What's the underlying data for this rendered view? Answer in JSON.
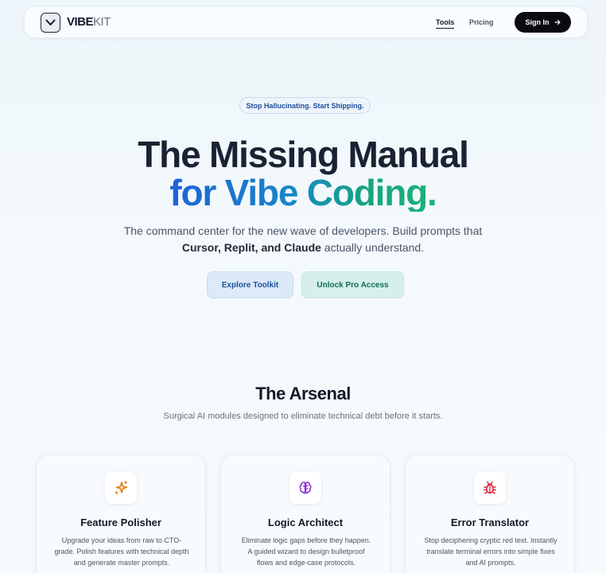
{
  "nav": {
    "logo_bold": "VIBE",
    "logo_thin": "KIT",
    "tools": "Tools",
    "pricing": "Pricing",
    "signin": "Sign In"
  },
  "hero": {
    "badge": "Stop Hallucinating. Start Shipping.",
    "title_line1": "The Missing Manual",
    "title_line2": "for Vibe Coding.",
    "sub_pre": "The command center for the new wave of developers. Build prompts that ",
    "sub_bold": "Cursor, Replit, and Claude",
    "sub_post": " actually understand.",
    "btn_explore": "Explore Toolkit",
    "btn_pro": "Unlock Pro Access"
  },
  "arsenal": {
    "title": "The Arsenal",
    "subtitle": "Surgical AI modules designed to eliminate technical debt before it starts.",
    "cards": [
      {
        "icon": "sparkles-icon",
        "title": "Feature Polisher",
        "desc": "Upgrade your ideas from raw to CTO-grade. Polish features with technical depth and generate master prompts."
      },
      {
        "icon": "brain-icon",
        "title": "Logic Architect",
        "desc": "Eliminate logic gaps before they happen. A guided wizard to design bulletproof flows and edge-case protocols."
      },
      {
        "icon": "bug-icon",
        "title": "Error Translator",
        "desc": "Stop deciphering cryptic red text. Instantly translate terminal errors into simple fixes and AI prompts."
      }
    ]
  },
  "colors": {
    "accent_blue": "#1e62d8",
    "accent_green": "#16a57f",
    "sparkles_orange": "#e07b1a",
    "brain_purple": "#8b2fd6",
    "bug_red": "#d8273f"
  }
}
